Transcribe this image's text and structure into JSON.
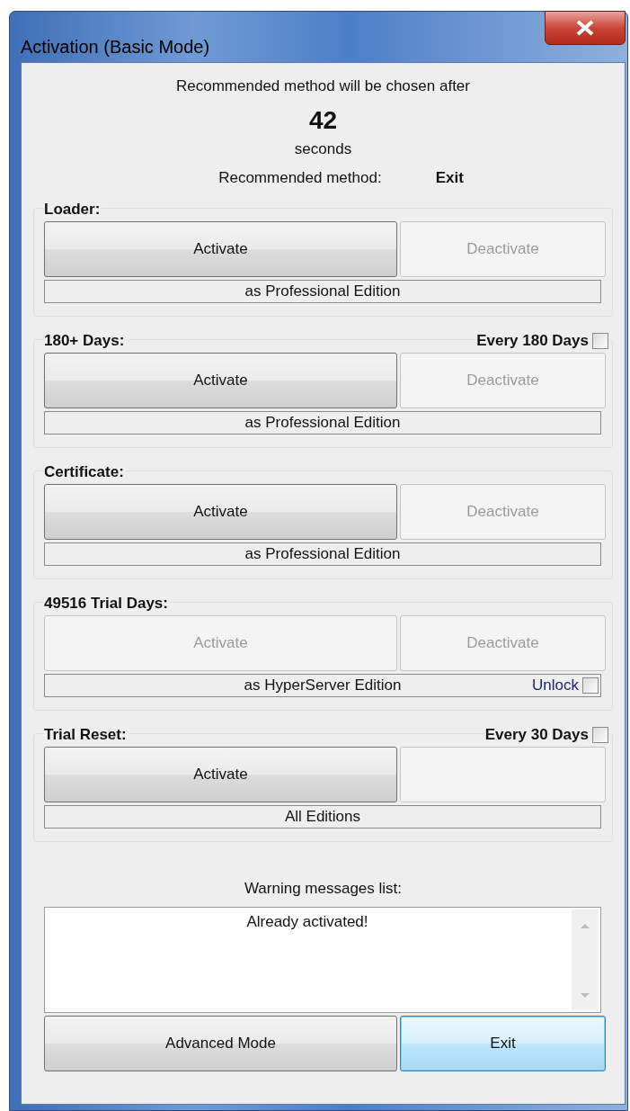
{
  "window": {
    "title": "Activation (Basic Mode)"
  },
  "countdown": {
    "caption": "Recommended method will be chosen after",
    "value": "42",
    "unit": "seconds"
  },
  "recommended": {
    "label": "Recommended method:",
    "value": "Exit"
  },
  "groups": [
    {
      "title": "Loader:",
      "activate": {
        "label": "Activate",
        "disabled": false
      },
      "deactivate": {
        "label": "Deactivate",
        "disabled": true
      },
      "edition": {
        "label": "as Professional Edition"
      }
    },
    {
      "title": "180+ Days:",
      "option": {
        "label": "Every 180 Days",
        "checked": false
      },
      "activate": {
        "label": "Activate",
        "disabled": false
      },
      "deactivate": {
        "label": "Deactivate",
        "disabled": true
      },
      "edition": {
        "label": "as Professional Edition"
      }
    },
    {
      "title": "Certificate:",
      "activate": {
        "label": "Activate",
        "disabled": false
      },
      "deactivate": {
        "label": "Deactivate",
        "disabled": true
      },
      "edition": {
        "label": "as Professional Edition"
      }
    },
    {
      "title": "49516 Trial Days:",
      "activate": {
        "label": "Activate",
        "disabled": true
      },
      "deactivate": {
        "label": "Deactivate",
        "disabled": true
      },
      "edition": {
        "label": "as HyperServer Edition",
        "option": {
          "label": "Unlock",
          "checked": false
        }
      }
    },
    {
      "title": "Trial Reset:",
      "option": {
        "label": "Every 30 Days",
        "checked": false
      },
      "activate": {
        "label": "Activate",
        "disabled": false
      },
      "deactivate": {
        "disabled": true
      },
      "edition": {
        "label": "All Editions"
      }
    }
  ],
  "warnings": {
    "label": "Warning messages list:",
    "items": [
      "Already activated!"
    ]
  },
  "buttons": [
    {
      "label": "Advanced Mode",
      "focused": false
    },
    {
      "label": "Exit",
      "focused": true
    }
  ]
}
